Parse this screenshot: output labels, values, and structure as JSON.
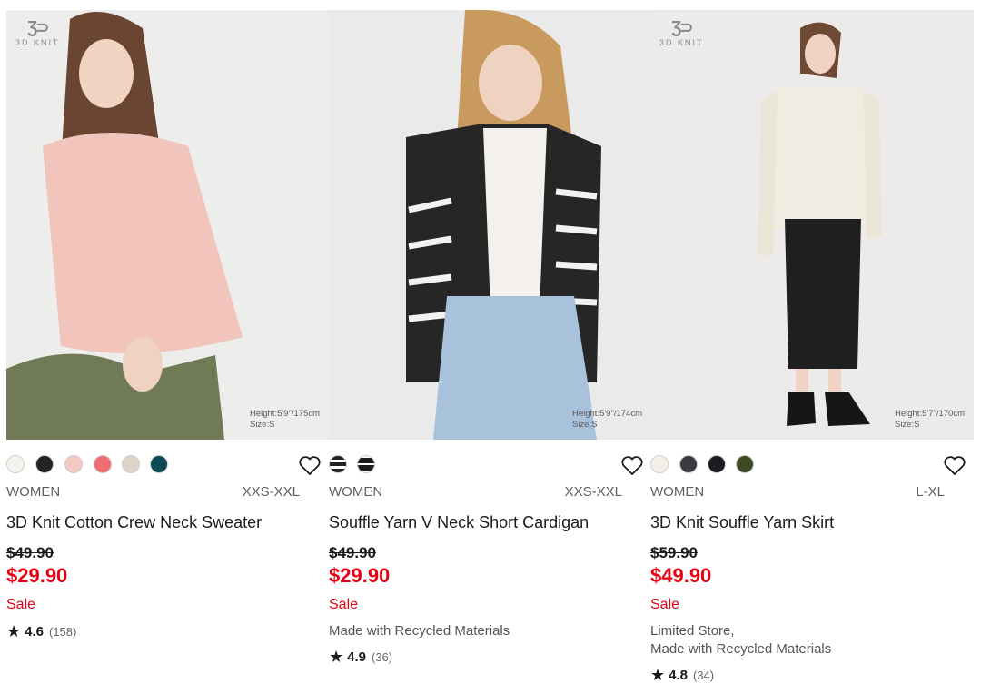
{
  "products": [
    {
      "badge": "3D KNIT",
      "model_info": [
        "Height:5'9\"/175cm",
        "Size:S"
      ],
      "swatches": [
        "#f4f4ef",
        "#222326",
        "#f3c9c3",
        "#ee6f73",
        "#dcd5c5",
        "#0f4b57"
      ],
      "gender": "WOMEN",
      "sizes": "XXS-XXL",
      "name": "3D Knit Cotton Crew Neck Sweater",
      "original_price": "$49.90",
      "sale_price": "$29.90",
      "flag": "Sale",
      "features": "",
      "rating": "4.6",
      "reviews": "(158)"
    },
    {
      "badge": "",
      "model_info": [
        "Height:5'9\"/174cm",
        "Size:S"
      ],
      "swatches": [
        "stripe-light",
        "stripe-dark"
      ],
      "gender": "WOMEN",
      "sizes": "XXS-XXL",
      "name": "Souffle Yarn V Neck Short Cardigan",
      "original_price": "$49.90",
      "sale_price": "$29.90",
      "flag": "Sale",
      "features": "Made with Recycled Materials",
      "rating": "4.9",
      "reviews": "(36)"
    },
    {
      "badge": "3D KNIT",
      "model_info": [
        "Height:5'7\"/170cm",
        "Size:S"
      ],
      "swatches": [
        "#f2efe6",
        "#3a3b3f",
        "#1c1d20",
        "#3e4b26"
      ],
      "gender": "WOMEN",
      "sizes": "L-XL",
      "name": "3D Knit Souffle Yarn Skirt",
      "original_price": "$59.90",
      "sale_price": "$49.90",
      "flag": "Sale",
      "features": "Limited Store,\nMade with Recycled Materials",
      "rating": "4.8",
      "reviews": "(34)"
    }
  ],
  "colors": {
    "sale_red": "#e60012",
    "text": "#1b1b1b",
    "muted": "#5f5f5f"
  },
  "icons": {
    "favorite": "heart-outline-icon",
    "rating": "star-icon",
    "badge": "3d-knit-logo-icon"
  }
}
